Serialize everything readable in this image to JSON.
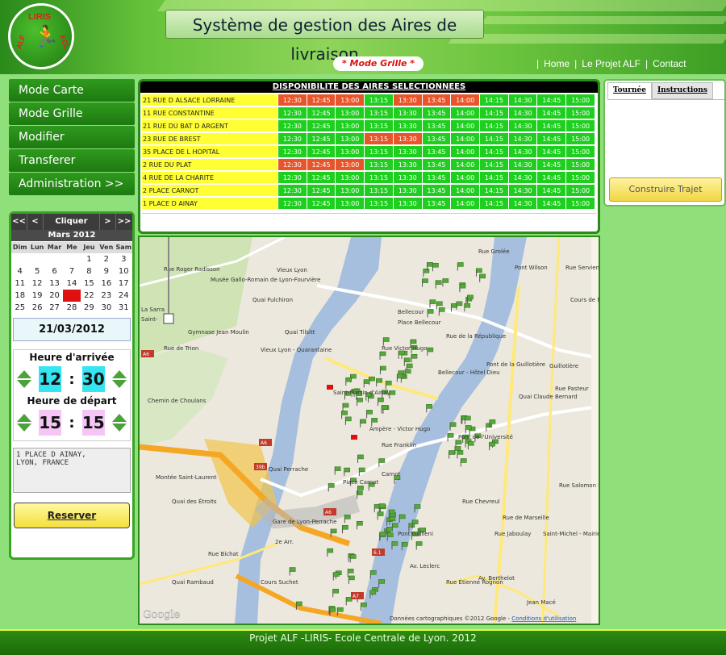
{
  "header": {
    "logo_top": "LIRIS",
    "logo_left": "ALF",
    "logo_right": "ECL",
    "title": "Système de gestion des Aires de livraison",
    "mode": "* Mode Grille *",
    "nav": [
      "Home",
      "Le Projet ALF",
      "Contact"
    ]
  },
  "sidebar": {
    "items": [
      "Mode Carte",
      "Mode Grille",
      "Modifier",
      "Transferer",
      "Administration >>"
    ]
  },
  "calendar": {
    "nav": [
      "<<",
      "<",
      "Cliquer",
      ">",
      ">>"
    ],
    "month": "Mars 2012",
    "days": [
      "Dim",
      "Lun",
      "Mar",
      "Me",
      "Jeu",
      "Ven",
      "Sam"
    ],
    "cells": [
      "",
      "",
      "",
      "",
      "1",
      "2",
      "3",
      "4",
      "5",
      "6",
      "7",
      "8",
      "9",
      "10",
      "11",
      "12",
      "13",
      "14",
      "15",
      "16",
      "17",
      "18",
      "19",
      "20",
      "21",
      "22",
      "23",
      "24",
      "25",
      "26",
      "27",
      "28",
      "29",
      "30",
      "31"
    ],
    "selected": "21",
    "date": "21/03/2012"
  },
  "arrival": {
    "title": "Heure d'arrivée",
    "hour": "12",
    "minute": "30",
    "color": "#33e6f2"
  },
  "departure": {
    "title": "Heure de départ",
    "hour": "15",
    "minute": "15",
    "color": "#f5c6f5"
  },
  "address": "1 PLACE D AINAY,\nLYON, FRANCE",
  "reserve_label": "Reserver",
  "availability": {
    "title": "DISPONIBILITE DES AIRES SELECTIONNEES",
    "times": [
      "12:30",
      "12:45",
      "13:00",
      "13:15",
      "13:30",
      "13:45",
      "14:00",
      "14:15",
      "14:30",
      "14:45",
      "15:00"
    ],
    "rows": [
      {
        "street": "21 RUE D ALSACE LORRAINE",
        "status": "rrrgrrrgggg"
      },
      {
        "street": "11 RUE CONSTANTINE",
        "status": "ggggggggggg"
      },
      {
        "street": "21 RUE DU BAT D ARGENT",
        "status": "ggggggggggg"
      },
      {
        "street": "23 RUE DE BREST",
        "status": "gggrrgggggg"
      },
      {
        "street": "35 PLACE DE L HOPITAL",
        "status": "ggggggggggg"
      },
      {
        "street": "2 RUE DU PLAT",
        "status": "rrrgggggggg"
      },
      {
        "street": "4 RUE DE LA CHARITE",
        "status": "ggggggggggg"
      },
      {
        "street": "2 PLACE CARNOT",
        "status": "ggggggggggg"
      },
      {
        "street": "1 PLACE D AINAY",
        "status": "ggggggggggg"
      }
    ]
  },
  "map": {
    "labels": [
      "Rue Roger Radisson",
      "Vieux Lyon",
      "Musée Gallo-Romain de Lyon-Fourvière",
      "La Sarra",
      "Saint-",
      "Gymnase Jean Moulin",
      "Rue de Trion",
      "Vieux Lyon - Quarantaine",
      "Quai Fulchiron",
      "Quai Tilsitt",
      "Bellecour",
      "Place Bellecour",
      "Rue de la République",
      "Pont Wilson",
      "Rue Servient",
      "Pont de la Guillotière",
      "Bellecour - Hôtel Dieu",
      "Rue Victor Hugo",
      "Saint-Martin d'Ainay",
      "Ampère - Victor Hugo",
      "Rue Franklin",
      "Carnot",
      "Place Carnot",
      "Pont de l'Université",
      "Quai Claude Bernard",
      "Guillotière",
      "Rue Pasteur",
      "Montée Saint-Laurent",
      "Quai des Étroits",
      "Gare de Lyon-Perrache",
      "2e Arr.",
      "Pont Gallieni",
      "Rue Chevreul",
      "Saint-Michel - Mairie",
      "Rue de Marseille",
      "Jean Macé",
      "Rue Bichat",
      "Cours Suchet",
      "Quai Rambaud",
      "Chemin de Choulans",
      "Rue Étienne Rognon",
      "Av. Berthelot",
      "Av. Leclerc",
      "Rue Grolée",
      "Rue Jaboulay",
      "Rue Salomon Reinach",
      "Quai Perrache",
      "Cours de la Liberté"
    ],
    "copyright": "Données cartographiques ©2012 Google - ",
    "terms": "Conditions d'utilisation",
    "google": "Google",
    "badges": [
      "A6",
      "A6",
      "A6",
      "A7",
      "39b",
      "6.1"
    ]
  },
  "rightpanel": {
    "tabs": [
      "Tournée",
      "Instructions"
    ],
    "build": "Construire Trajet"
  },
  "footer": "Projet ALF -LIRIS- Ecole Centrale de Lyon. 2012"
}
